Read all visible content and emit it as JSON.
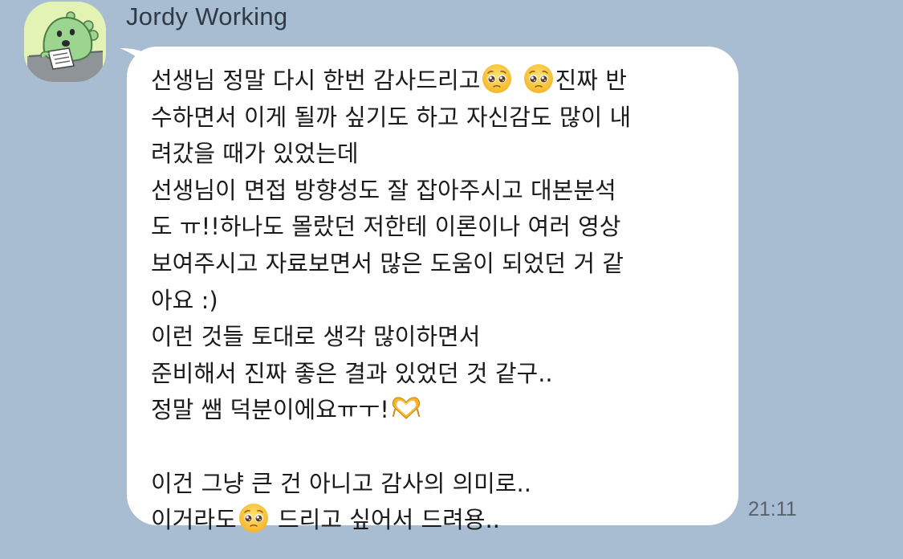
{
  "chat": {
    "sender_name": "Jordy Working",
    "avatar_icon": "jordy-dinosaur-avatar",
    "message": {
      "lines": [
        [
          {
            "t": "text",
            "v": "선생님 정말 다시 한번 감사드리고"
          },
          {
            "t": "emoji",
            "v": "pleading-face-emoji"
          },
          {
            "t": "text",
            "v": " "
          },
          {
            "t": "emoji",
            "v": "pleading-face-emoji"
          },
          {
            "t": "text",
            "v": "진짜 반"
          }
        ],
        [
          {
            "t": "text",
            "v": "수하면서 이게 될까 싶기도 하고 자신감도 많이 내"
          }
        ],
        [
          {
            "t": "text",
            "v": "려갔을 때가 있었는데"
          }
        ],
        [
          {
            "t": "text",
            "v": "선생님이 면접 방향성도 잘 잡아주시고 대본분석"
          }
        ],
        [
          {
            "t": "text",
            "v": "도 ㅠ!!하나도 몰랐던 저한테 이론이나 여러 영상"
          }
        ],
        [
          {
            "t": "text",
            "v": "보여주시고 자료보면서 많은 도움이 되었던 거 같"
          }
        ],
        [
          {
            "t": "text",
            "v": "아요 :)"
          }
        ],
        [
          {
            "t": "text",
            "v": "이런 것들 토대로 생각 많이하면서"
          }
        ],
        [
          {
            "t": "text",
            "v": "준비해서 진짜 좋은 결과 있었던 것 같구.."
          }
        ],
        [
          {
            "t": "text",
            "v": "정말 쌤 덕분이에요ㅠㅜ!"
          },
          {
            "t": "emoji",
            "v": "heart-hands-emoji"
          }
        ],
        [],
        [
          {
            "t": "text",
            "v": "이건 그냥 큰 건 아니고 감사의 의미로.."
          }
        ],
        [
          {
            "t": "text",
            "v": "이거라도"
          },
          {
            "t": "emoji",
            "v": "pleading-face-emoji"
          },
          {
            "t": "text",
            "v": " 드리고 싶어서 드려용.."
          }
        ]
      ]
    },
    "timestamp": "21:11"
  },
  "colors": {
    "background": "#a9bdd2",
    "bubble": "#ffffff",
    "avatar_background": "#e3f3b4",
    "character_green": "#9bd58f"
  }
}
